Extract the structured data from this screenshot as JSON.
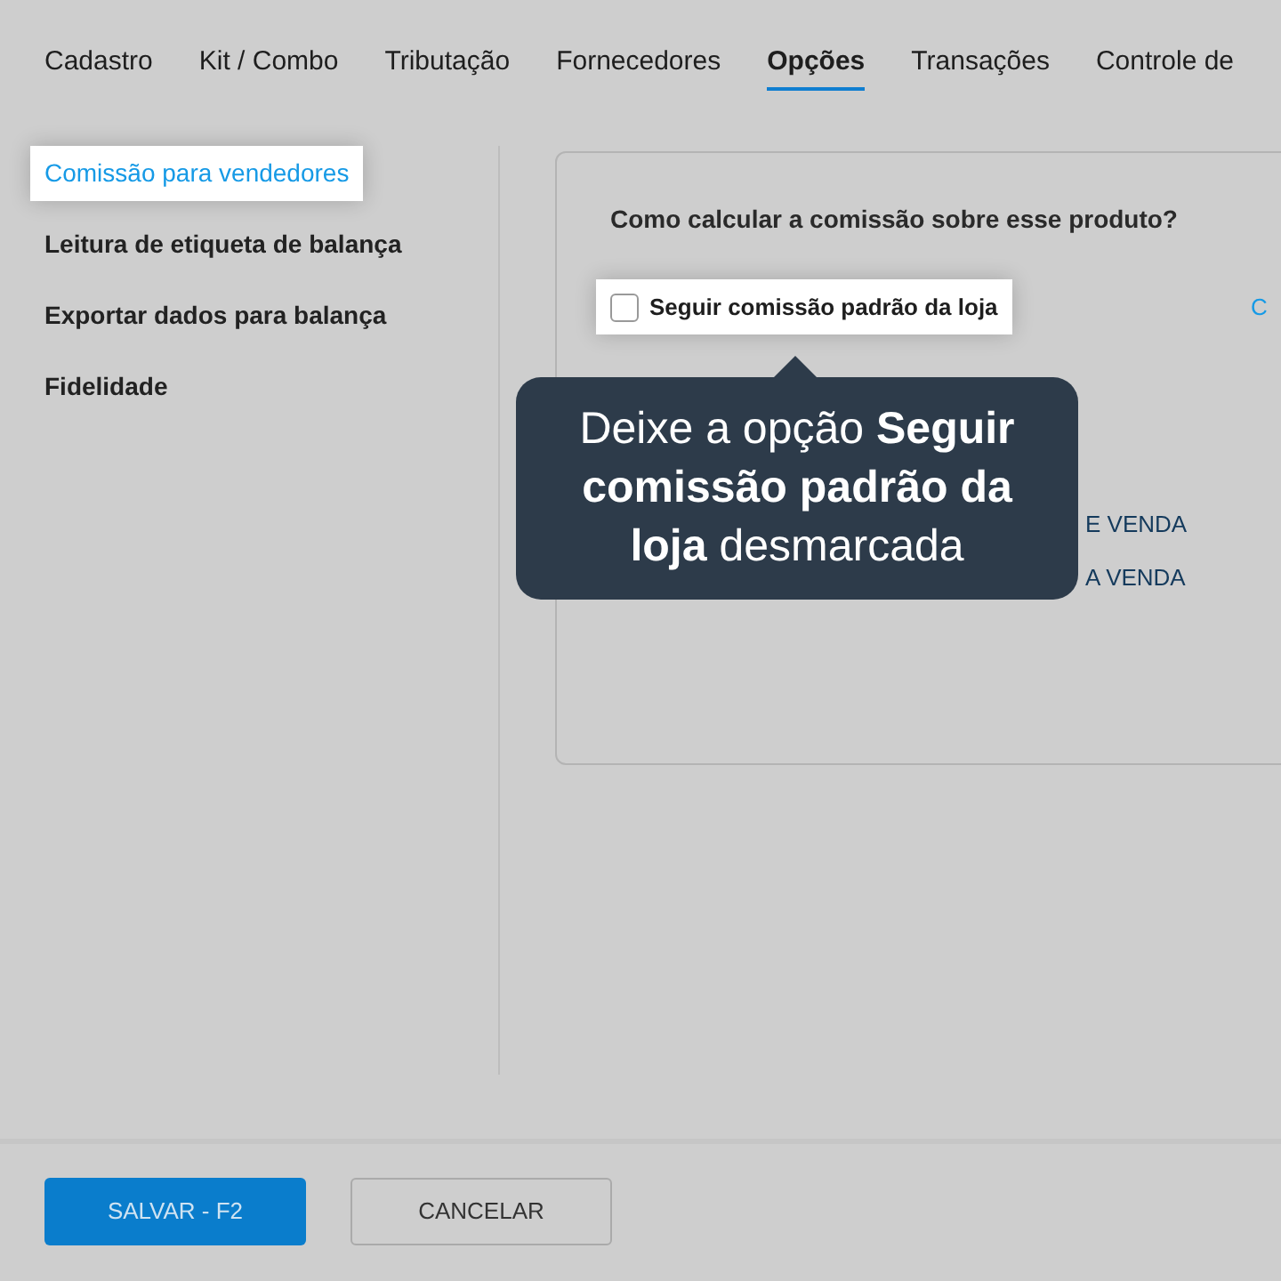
{
  "tabs": [
    {
      "label": "Cadastro",
      "selected": false
    },
    {
      "label": "Kit / Combo",
      "selected": false
    },
    {
      "label": "Tributação",
      "selected": false
    },
    {
      "label": "Fornecedores",
      "selected": false
    },
    {
      "label": "Opções",
      "selected": true
    },
    {
      "label": "Transações",
      "selected": false
    },
    {
      "label": "Controle de",
      "selected": false
    }
  ],
  "sidebar": {
    "items": [
      {
        "label": "Comissão para vendedores",
        "selected": true
      },
      {
        "label": "Leitura de etiqueta de balança",
        "selected": false
      },
      {
        "label": "Exportar dados para balança",
        "selected": false
      },
      {
        "label": "Fidelidade",
        "selected": false
      }
    ]
  },
  "panel": {
    "question": "Como calcular a comissão sobre esse produto?",
    "checkbox": {
      "label": "Seguir comissão padrão da loja",
      "checked": false
    },
    "link": "C",
    "options": [
      "E VENDA",
      "A VENDA"
    ]
  },
  "tooltip": {
    "text": "Deixe a opção **Seguir comissão padrão da loja** desmarcada"
  },
  "buttons": [
    {
      "label": "SALVAR - F2",
      "kind": "primary"
    },
    {
      "label": "CANCELAR",
      "kind": "secondary"
    }
  ]
}
